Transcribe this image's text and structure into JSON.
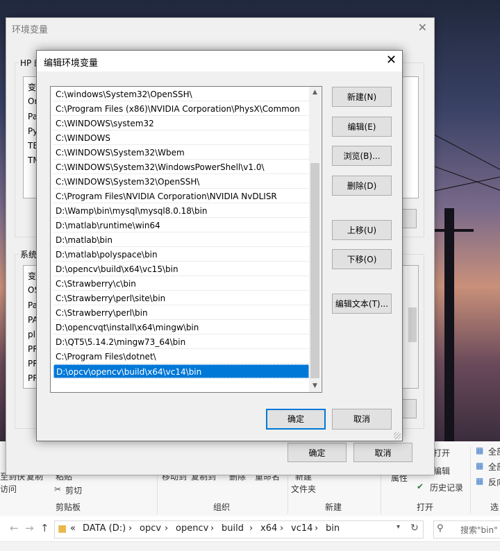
{
  "edit_dialog": {
    "title": "编辑环境变量",
    "close_glyph": "✕",
    "paths": [
      "C:\\windows\\System32\\OpenSSH\\",
      "C:\\Program Files (x86)\\NVIDIA Corporation\\PhysX\\Common",
      "C:\\WINDOWS\\system32",
      "C:\\WINDOWS",
      "C:\\WINDOWS\\System32\\Wbem",
      "C:\\WINDOWS\\System32\\WindowsPowerShell\\v1.0\\",
      "C:\\WINDOWS\\System32\\OpenSSH\\",
      "C:\\Program Files\\NVIDIA Corporation\\NVIDIA NvDLISR",
      "D:\\Wamp\\bin\\mysql\\mysql8.0.18\\bin",
      "D:\\matlab\\runtime\\win64",
      "D:\\matlab\\bin",
      "D:\\matlab\\polyspace\\bin",
      "D:\\opencv\\build\\x64\\vc15\\bin",
      "C:\\Strawberry\\c\\bin",
      "C:\\Strawberry\\perl\\site\\bin",
      "C:\\Strawberry\\perl\\bin",
      "D:\\opencvqt\\install\\x64\\mingw\\bin",
      "D:\\QT5\\5.14.2\\mingw73_64\\bin",
      "C:\\Program Files\\dotnet\\",
      "D:\\opcv\\opencv\\build\\x64\\vc14\\bin"
    ],
    "selected_index": 19,
    "buttons": {
      "new": "新建(N)",
      "edit": "编辑(E)",
      "browse": "浏览(B)...",
      "delete": "删除(D)",
      "move_up": "上移(U)",
      "move_down": "下移(O)",
      "edit_text": "编辑文本(T)...",
      "ok": "确定",
      "cancel": "取消"
    }
  },
  "env_dialog": {
    "title": "环境变量",
    "close_glyph": "✕",
    "user_group_label": "HP 的",
    "user_list": [
      "变",
      "On",
      "Pa",
      "Py",
      "TE",
      "TM"
    ],
    "system_group_label": "系统",
    "system_list": [
      "变",
      "OS",
      "Pa",
      "PA",
      "pl",
      "PR",
      "PR",
      "PR"
    ],
    "ok": "确定",
    "cancel": "取消"
  },
  "explorer": {
    "ribbon": {
      "left_items": [
        "至到快",
        "访问",
        "复制",
        "粘贴"
      ],
      "cut": "剪切",
      "clipboard_group": "剪贴板",
      "move_to": "移动到",
      "copy_to": "复制到",
      "delete": "删除",
      "rename": "重命名",
      "organize_group": "组织",
      "new_folder_line1": "新建",
      "new_folder_line2": "文件夹",
      "new_group": "新建",
      "open_dropdown": "打开",
      "edit": "编辑",
      "properties": "属性",
      "history": "历史记录",
      "open_group": "打开",
      "select_all": "全部",
      "select_none": "全部",
      "invert": "反向",
      "select_group": "选"
    },
    "address": {
      "overflow": "«",
      "crumbs": [
        "DATA (D:)",
        "opcv",
        "opencv",
        "build",
        "x64",
        "vc14",
        "bin"
      ],
      "separator": "›",
      "search_placeholder": "搜索\"bin\""
    }
  },
  "colors": {
    "selection": "#0078d7",
    "dialog_bg": "#f0f0f0",
    "button_bg": "#e1e1e1"
  }
}
